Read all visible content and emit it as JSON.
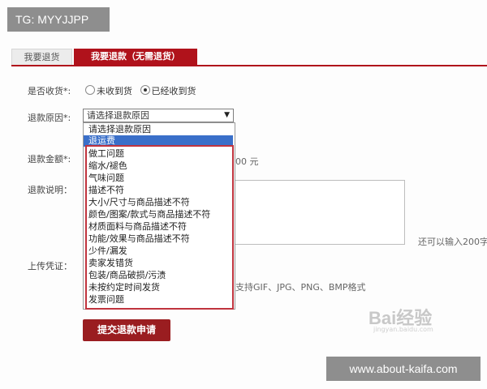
{
  "badge": "TG: MYYJJPP",
  "tabs": [
    {
      "label": "我要退货"
    },
    {
      "label": "我要退款（无需退货）"
    }
  ],
  "form": {
    "received_label": "是否收货*:",
    "received_options": [
      {
        "label": "未收到货",
        "checked": false
      },
      {
        "label": "已经收到货",
        "checked": true
      }
    ],
    "reason_label": "退款原因*:",
    "reason_selected": "请选择退款原因",
    "amount_label": "退款金额*:",
    "amount_suffix": "00 元",
    "description_label": "退款说明：",
    "char_hint": "还可以输入200字",
    "upload_label": "上传凭证：",
    "upload_hint": "支持GIF、JPG、PNG、BMP格式",
    "submit": "提交退款申请"
  },
  "dropdown": {
    "options": [
      "请选择退款原因",
      "退运费",
      "做工问题",
      "缩水/褪色",
      "气味问题",
      "描述不符",
      "大小/尺寸与商品描述不符",
      "颜色/图案/款式与商品描述不符",
      "材质面料与商品描述不符",
      "功能/效果与商品描述不符",
      "少件/漏发",
      "卖家发错货",
      "包装/商品破损/污渍",
      "未按约定时间发货",
      "发票问题"
    ],
    "highlighted_index": 1
  },
  "watermarks": {
    "baidu": "Bai经验",
    "baidu_sub": "jingyan.baidu.com",
    "site": "www.about-kaifa.com"
  }
}
